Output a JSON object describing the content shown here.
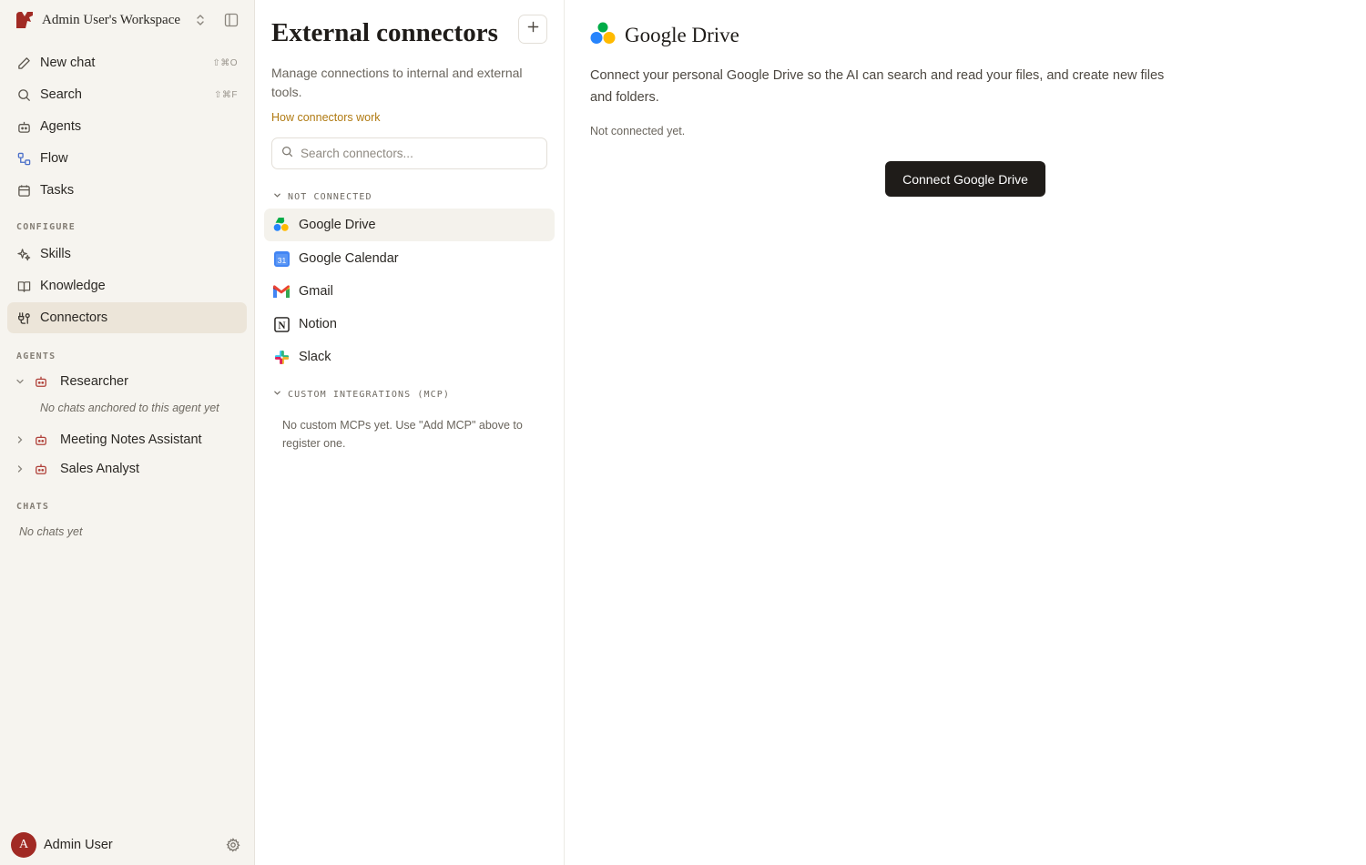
{
  "workspace": {
    "name": "Admin User's Workspace"
  },
  "nav": {
    "new_chat": {
      "label": "New chat",
      "shortcut": "⇧⌘O"
    },
    "search": {
      "label": "Search",
      "shortcut": "⇧⌘F"
    },
    "agents": {
      "label": "Agents"
    },
    "flow": {
      "label": "Flow"
    },
    "tasks": {
      "label": "Tasks"
    }
  },
  "configure": {
    "label": "CONFIGURE",
    "skills": "Skills",
    "knowledge": "Knowledge",
    "connectors": "Connectors"
  },
  "agents_section": {
    "label": "AGENTS",
    "items": [
      {
        "name": "Researcher",
        "expanded": true,
        "note": "No chats anchored to this agent yet"
      },
      {
        "name": "Meeting Notes Assistant",
        "expanded": false
      },
      {
        "name": "Sales Analyst",
        "expanded": false
      }
    ]
  },
  "chats_section": {
    "label": "CHATS",
    "empty": "No chats yet"
  },
  "user": {
    "name": "Admin User",
    "initial": "A"
  },
  "connectors_panel": {
    "title": "External connectors",
    "description": "Manage connections to internal and external tools.",
    "how_link": "How connectors work",
    "search_placeholder": "Search connectors...",
    "not_connected_label": "NOT CONNECTED",
    "items": [
      {
        "name": "Google Drive",
        "icon": "google-drive-icon",
        "active": true
      },
      {
        "name": "Google Calendar",
        "icon": "google-calendar-icon",
        "active": false
      },
      {
        "name": "Gmail",
        "icon": "gmail-icon",
        "active": false
      },
      {
        "name": "Notion",
        "icon": "notion-icon",
        "active": false
      },
      {
        "name": "Slack",
        "icon": "slack-icon",
        "active": false
      }
    ],
    "custom_label": "CUSTOM INTEGRATIONS (MCP)",
    "custom_empty": "No custom MCPs yet. Use \"Add MCP\" above to register one."
  },
  "detail": {
    "title": "Google Drive",
    "description": "Connect your personal Google Drive so the AI can search and read your files, and create new files and folders.",
    "status": "Not connected yet.",
    "connect_label": "Connect Google Drive"
  },
  "colors": {
    "sidebar_bg": "#f6f4ef",
    "active_nav_bg": "#ece5d9",
    "brand_red": "#a12a24",
    "link_gold": "#b07a12",
    "button_dark": "#1f1c19"
  }
}
